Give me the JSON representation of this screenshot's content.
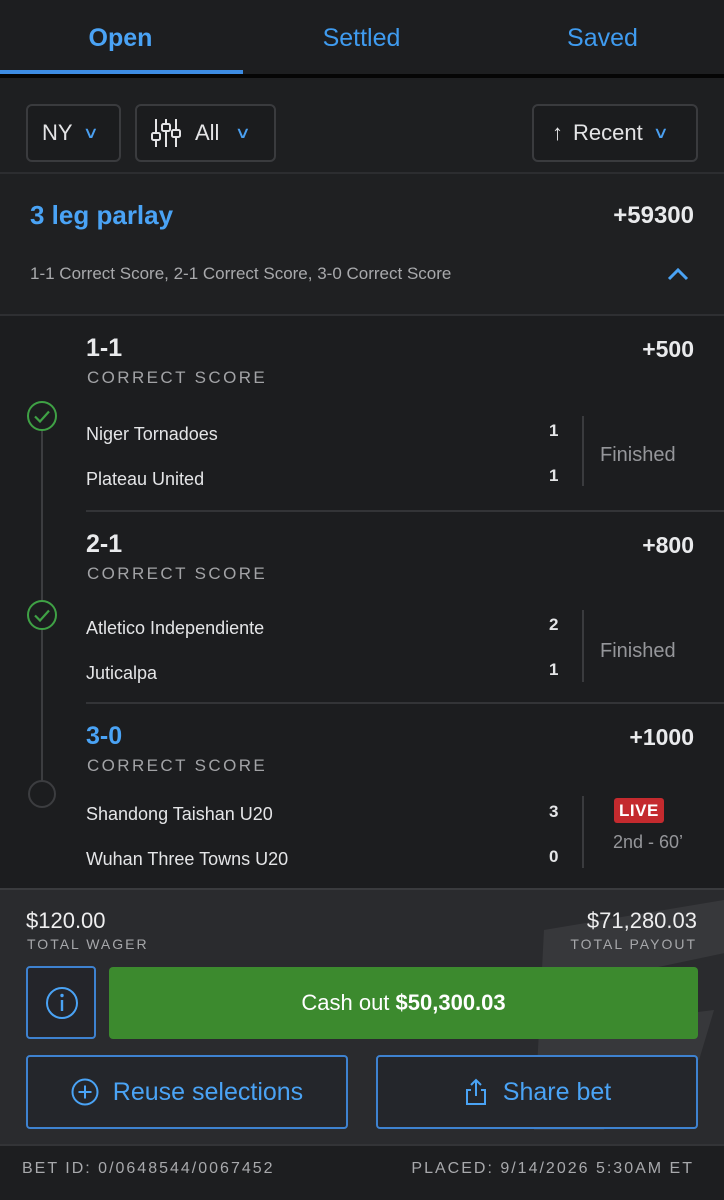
{
  "tabs": [
    {
      "label": "Open",
      "active": true
    },
    {
      "label": "Settled",
      "active": false
    },
    {
      "label": "Saved",
      "active": false
    }
  ],
  "filters": {
    "state": "NY",
    "type": "All",
    "sort": "Recent"
  },
  "parlay": {
    "title": "3 leg parlay",
    "odds": "+59300",
    "summary": "1-1 Correct Score, 2-1 Correct Score, 3-0 Correct Score"
  },
  "legs": [
    {
      "score": "1-1",
      "market": "CORRECT SCORE",
      "odds": "+500",
      "home": "Niger Tornadoes",
      "home_score": "1",
      "away": "Plateau United",
      "away_score": "1",
      "status": "Finished",
      "result": "won"
    },
    {
      "score": "2-1",
      "market": "CORRECT SCORE",
      "odds": "+800",
      "home": "Atletico Independiente",
      "home_score": "2",
      "away": "Juticalpa",
      "away_score": "1",
      "status": "Finished",
      "result": "won"
    },
    {
      "score": "3-0",
      "market": "CORRECT SCORE",
      "odds": "+1000",
      "home": "Shandong Taishan U20",
      "home_score": "3",
      "away": "Wuhan Three Towns U20",
      "away_score": "0",
      "live_badge": "LIVE",
      "live_time": "2nd - 60’",
      "result": "pending"
    }
  ],
  "footer": {
    "wager": "$120.00",
    "wager_label": "TOTAL WAGER",
    "payout": "$71,280.03",
    "payout_label": "TOTAL PAYOUT",
    "cashout_prefix": "Cash out",
    "cashout_amount": "$50,300.03",
    "reuse_label": "Reuse selections",
    "share_label": "Share bet"
  },
  "meta": {
    "bet_id": "BET ID: 0/0648544/0067452",
    "placed": "PLACED: 9/14/2026  5:30AM ET"
  },
  "colors": {
    "accent": "#4aa3f5",
    "cashout_green": "#3c8a2e",
    "check_green": "#3fa145",
    "live_red": "#c42a2e",
    "background": "#1e1f21"
  }
}
